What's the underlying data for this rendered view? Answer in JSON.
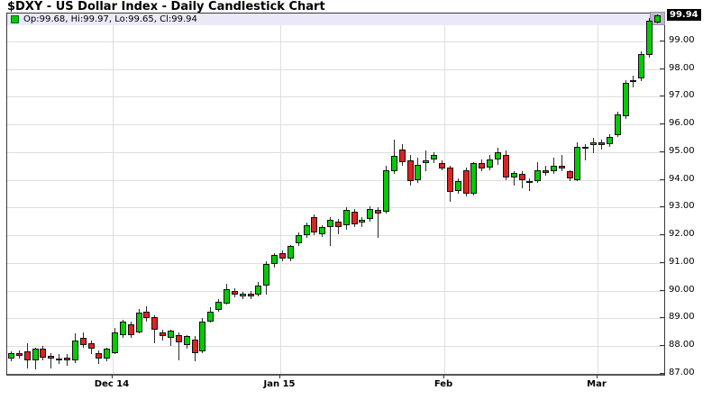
{
  "title": "$DXY - US Dollar Index - Daily Candlestick Chart",
  "legend": {
    "text": "Op:99.68, Hi:99.97, Lo:99.65, Cl:99.94",
    "swatch_color": "#00cc00"
  },
  "price_label": "99.94",
  "chart_data": {
    "type": "candlestick",
    "symbol": "$DXY",
    "title": "US Dollar Index - Daily Candlestick Chart",
    "timeframe": "Daily",
    "legend_position": "top-left",
    "grid": true,
    "y_axis": {
      "side": "right",
      "min": 87,
      "max": 100,
      "tick_step": 1,
      "ticks": [
        {
          "v": 99,
          "label": "99.00"
        },
        {
          "v": 98,
          "label": "98.00"
        },
        {
          "v": 97,
          "label": "97.00"
        },
        {
          "v": 96,
          "label": "96.00"
        },
        {
          "v": 95,
          "label": "95.00"
        },
        {
          "v": 94,
          "label": "94.00"
        },
        {
          "v": 93,
          "label": "93.00"
        },
        {
          "v": 92,
          "label": "92.00"
        },
        {
          "v": 91,
          "label": "91.00"
        },
        {
          "v": 90,
          "label": "90.00"
        },
        {
          "v": 89,
          "label": "89.00"
        },
        {
          "v": 88,
          "label": "88.00"
        },
        {
          "v": 87,
          "label": "87.00"
        }
      ]
    },
    "x_axis": {
      "ticks": [
        {
          "label": "Dec 14",
          "x_pct": 16.0
        },
        {
          "label": "Jan 15",
          "x_pct": 41.6
        },
        {
          "label": "Feb",
          "x_pct": 66.5
        },
        {
          "label": "Mar",
          "x_pct": 89.8
        }
      ]
    },
    "colors": {
      "up": "#00cc00",
      "down": "#dd2222",
      "wick": "#2b2b2b",
      "grid": "#dedede",
      "legend_band": "#e9e9f8",
      "highlight_box": "#b9b9c6",
      "price_tag_bg": "#000000",
      "price_tag_text": "#ffffff"
    },
    "current_price": 99.94,
    "last_ohlc": {
      "open": 99.68,
      "high": 99.97,
      "low": 99.65,
      "close": 99.94
    },
    "candles": [
      [
        87.55,
        87.8,
        87.45,
        87.75
      ],
      [
        87.75,
        87.85,
        87.55,
        87.65
      ],
      [
        87.8,
        88.1,
        87.2,
        87.5
      ],
      [
        87.5,
        87.95,
        87.15,
        87.9
      ],
      [
        87.9,
        88.0,
        87.5,
        87.6
      ],
      [
        87.65,
        87.75,
        87.2,
        87.55
      ],
      [
        87.55,
        87.7,
        87.35,
        87.5
      ],
      [
        87.6,
        87.7,
        87.3,
        87.5
      ],
      [
        87.5,
        88.45,
        87.4,
        88.2
      ],
      [
        88.3,
        88.5,
        87.95,
        88.05
      ],
      [
        88.1,
        88.2,
        87.7,
        87.9
      ],
      [
        87.75,
        87.85,
        87.35,
        87.55
      ],
      [
        87.55,
        87.95,
        87.45,
        87.9
      ],
      [
        87.75,
        88.65,
        87.7,
        88.5
      ],
      [
        88.4,
        88.95,
        88.3,
        88.9
      ],
      [
        88.8,
        88.9,
        88.3,
        88.4
      ],
      [
        88.5,
        89.35,
        88.45,
        89.2
      ],
      [
        89.25,
        89.45,
        88.9,
        89.0
      ],
      [
        89.05,
        89.1,
        88.1,
        88.6
      ],
      [
        88.5,
        88.6,
        88.2,
        88.35
      ],
      [
        88.3,
        88.6,
        88.0,
        88.55
      ],
      [
        88.4,
        88.5,
        87.5,
        88.15
      ],
      [
        88.05,
        88.4,
        87.9,
        88.35
      ],
      [
        88.25,
        88.35,
        87.45,
        87.75
      ],
      [
        87.8,
        89.0,
        87.75,
        88.9
      ],
      [
        88.9,
        89.4,
        88.85,
        89.25
      ],
      [
        89.3,
        89.7,
        89.25,
        89.6
      ],
      [
        89.55,
        90.25,
        89.5,
        90.05
      ],
      [
        90.0,
        90.1,
        89.75,
        89.85
      ],
      [
        89.8,
        89.95,
        89.7,
        89.9
      ],
      [
        89.9,
        90.0,
        89.7,
        89.8
      ],
      [
        89.85,
        90.3,
        89.8,
        90.2
      ],
      [
        90.2,
        91.05,
        89.85,
        90.95
      ],
      [
        90.95,
        91.35,
        90.85,
        91.3
      ],
      [
        91.35,
        91.45,
        91.05,
        91.15
      ],
      [
        91.15,
        91.65,
        91.05,
        91.6
      ],
      [
        91.7,
        92.1,
        91.6,
        92.0
      ],
      [
        92.0,
        92.45,
        91.9,
        92.35
      ],
      [
        92.65,
        92.75,
        92.0,
        92.1
      ],
      [
        92.05,
        92.35,
        91.95,
        92.3
      ],
      [
        92.3,
        92.65,
        91.6,
        92.55
      ],
      [
        92.5,
        92.6,
        92.05,
        92.3
      ],
      [
        92.35,
        93.0,
        92.2,
        92.9
      ],
      [
        92.85,
        92.95,
        92.3,
        92.4
      ],
      [
        92.45,
        92.65,
        92.3,
        92.55
      ],
      [
        92.6,
        93.05,
        92.5,
        92.95
      ],
      [
        92.9,
        93.0,
        91.9,
        92.8
      ],
      [
        92.85,
        94.5,
        92.8,
        94.35
      ],
      [
        94.3,
        95.45,
        94.2,
        94.85
      ],
      [
        95.1,
        95.3,
        94.5,
        94.65
      ],
      [
        94.7,
        94.9,
        93.8,
        93.95
      ],
      [
        94.0,
        94.8,
        93.9,
        94.55
      ],
      [
        94.6,
        95.05,
        94.3,
        94.7
      ],
      [
        94.75,
        95.0,
        94.6,
        94.9
      ],
      [
        94.6,
        94.7,
        94.35,
        94.4
      ],
      [
        94.45,
        94.5,
        93.2,
        93.55
      ],
      [
        93.6,
        94.05,
        93.5,
        93.95
      ],
      [
        94.35,
        94.45,
        93.4,
        93.5
      ],
      [
        93.5,
        94.65,
        93.45,
        94.6
      ],
      [
        94.6,
        94.75,
        94.3,
        94.4
      ],
      [
        94.45,
        94.9,
        94.35,
        94.75
      ],
      [
        94.75,
        95.15,
        94.55,
        95.0
      ],
      [
        94.9,
        95.05,
        94.0,
        94.1
      ],
      [
        94.1,
        94.3,
        93.8,
        94.25
      ],
      [
        94.2,
        94.3,
        93.7,
        94.0
      ],
      [
        93.95,
        94.05,
        93.6,
        93.95
      ],
      [
        93.95,
        94.65,
        93.9,
        94.35
      ],
      [
        94.35,
        94.5,
        94.15,
        94.25
      ],
      [
        94.3,
        94.8,
        94.2,
        94.5
      ],
      [
        94.5,
        94.9,
        94.3,
        94.4
      ],
      [
        94.3,
        94.35,
        93.95,
        94.05
      ],
      [
        94.0,
        95.35,
        93.95,
        95.2
      ],
      [
        95.15,
        95.3,
        94.7,
        95.2
      ],
      [
        95.25,
        95.5,
        94.95,
        95.35
      ],
      [
        95.35,
        95.45,
        95.1,
        95.25
      ],
      [
        95.3,
        95.65,
        95.2,
        95.55
      ],
      [
        95.6,
        96.45,
        95.55,
        96.35
      ],
      [
        96.3,
        97.6,
        96.2,
        97.5
      ],
      [
        97.55,
        97.75,
        97.35,
        97.6
      ],
      [
        97.65,
        98.65,
        97.55,
        98.55
      ],
      [
        98.5,
        99.85,
        98.4,
        99.75
      ],
      [
        99.68,
        99.97,
        99.65,
        99.94
      ]
    ]
  }
}
